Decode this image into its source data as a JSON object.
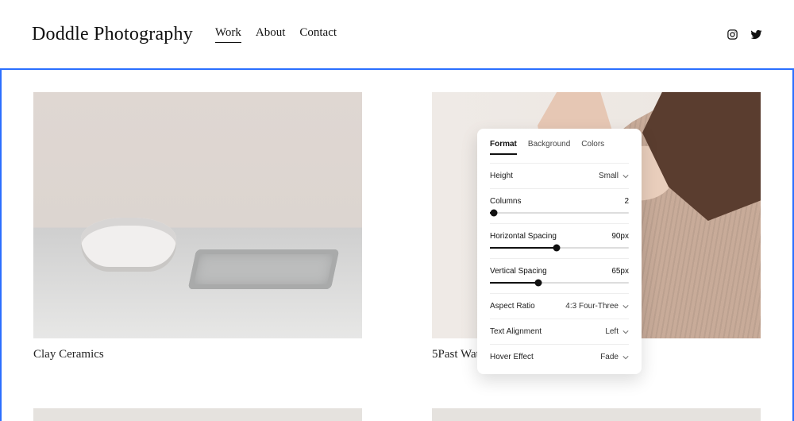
{
  "header": {
    "site_title": "Doddle Photography",
    "nav": [
      "Work",
      "About",
      "Contact"
    ],
    "active_nav_index": 0,
    "social": [
      "instagram-icon",
      "twitter-icon"
    ]
  },
  "grid": {
    "cards": [
      {
        "caption": "Clay Ceramics"
      },
      {
        "caption": "5Past Watch"
      }
    ]
  },
  "panel": {
    "tabs": [
      "Format",
      "Background",
      "Colors"
    ],
    "active_tab_index": 0,
    "rows": {
      "height": {
        "label": "Height",
        "value": "Small"
      },
      "columns": {
        "label": "Columns",
        "value": "2",
        "slider_percent": 3
      },
      "h_spacing": {
        "label": "Horizontal Spacing",
        "value": "90px",
        "slider_percent": 48
      },
      "v_spacing": {
        "label": "Vertical Spacing",
        "value": "65px",
        "slider_percent": 35
      },
      "aspect": {
        "label": "Aspect Ratio",
        "value": "4:3 Four-Three"
      },
      "text_align": {
        "label": "Text Alignment",
        "value": "Left"
      },
      "hover": {
        "label": "Hover Effect",
        "value": "Fade"
      }
    }
  }
}
